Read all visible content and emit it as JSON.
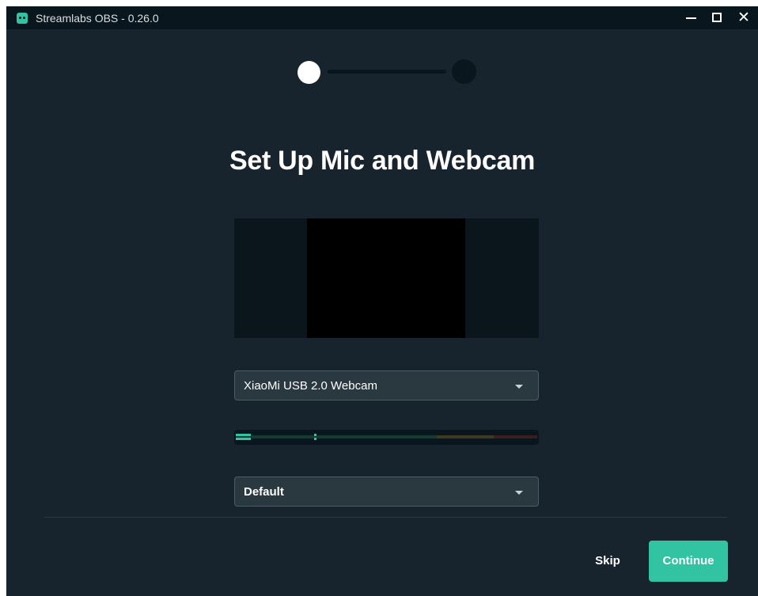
{
  "window": {
    "title": "Streamlabs OBS - 0.26.0",
    "icon": "streamlabs-logo-icon"
  },
  "titlebar_controls": [
    "minimize-icon",
    "maximize-icon",
    "close-icon"
  ],
  "close_glyph": "✕",
  "stepper": {
    "steps": 2,
    "current_step": 1
  },
  "heading": "Set Up Mic and Webcam",
  "webcam": {
    "selected": "XiaoMi USB 2.0 Webcam"
  },
  "audio_meter": {
    "level_fraction": 0.05,
    "peak_fraction": 0.26
  },
  "microphone": {
    "selected": "Default"
  },
  "actions": {
    "skip_label": "Skip",
    "continue_label": "Continue"
  },
  "colors": {
    "accent": "#31c3a2",
    "background": "#17242d",
    "titlebar": "#09161d"
  }
}
